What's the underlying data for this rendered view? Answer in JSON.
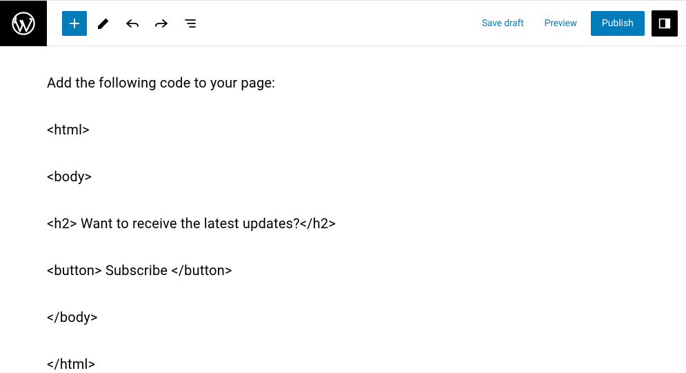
{
  "toolbar": {
    "add_button": "+",
    "save_draft_label": "Save draft",
    "preview_label": "Preview",
    "publish_label": "Publish"
  },
  "editor": {
    "lines": [
      "Add the following code to your page:",
      "<html>",
      "<body>",
      "<h2> Want to receive the latest updates?</h2>",
      "<button> Subscribe </button>",
      "</body>",
      "</html>"
    ]
  },
  "icons": {
    "wordpress": "wordpress-logo",
    "add": "plus-icon",
    "edit": "pencil-icon",
    "undo": "undo-icon",
    "redo": "redo-icon",
    "outline": "list-view-icon",
    "sidebar": "settings-sidebar-icon"
  },
  "colors": {
    "primary": "#007cba",
    "dark": "#000000",
    "border": "#e0e0e0"
  }
}
